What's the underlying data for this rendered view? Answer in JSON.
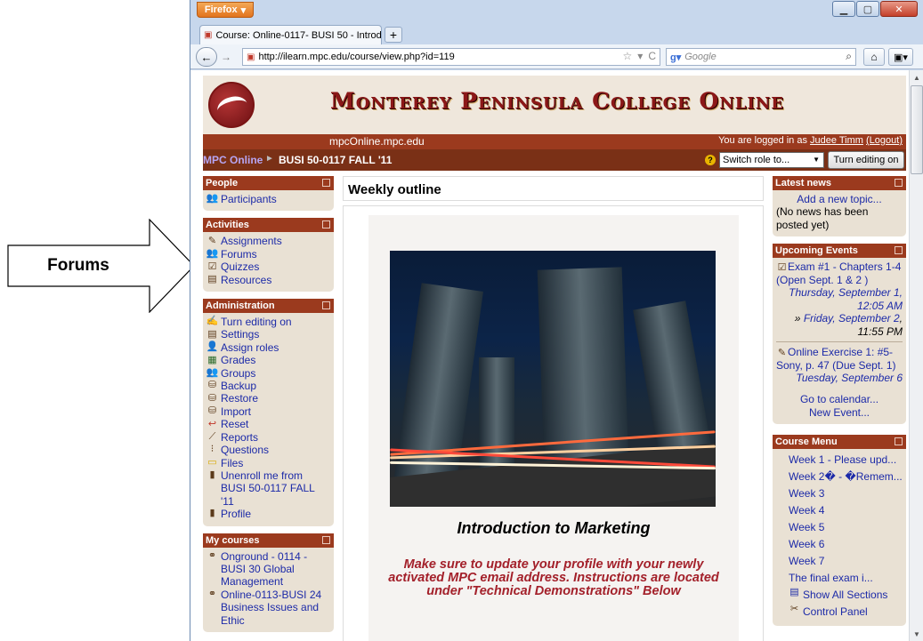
{
  "callout": {
    "label": "Forums"
  },
  "browser": {
    "app_button": "Firefox",
    "tab_title": "Course: Online-0117- BUSI 50 - Introduct...",
    "url": "http://ilearn.mpc.edu/course/view.php?id=119",
    "search_placeholder": "Google"
  },
  "header": {
    "site_title": "Monterey Peninsula College Online",
    "subdomain": "mpcOnline.mpc.edu",
    "login_prefix": "You are logged in as ",
    "user_name": "Judee Timm",
    "logout": "(Logout)"
  },
  "breadcrumb": {
    "root": "MPC Online",
    "separator": "►",
    "course": "BUSI 50-0117 FALL '11"
  },
  "controls": {
    "role_select": "Switch role to...",
    "edit_button": "Turn editing on"
  },
  "blocks": {
    "people": {
      "title": "People",
      "items": [
        {
          "label": "Participants",
          "icon": "participants-icon"
        }
      ]
    },
    "activities": {
      "title": "Activities",
      "items": [
        {
          "label": "Assignments",
          "icon": "assignment-icon"
        },
        {
          "label": "Forums",
          "icon": "forum-icon"
        },
        {
          "label": "Quizzes",
          "icon": "quiz-icon"
        },
        {
          "label": "Resources",
          "icon": "resource-icon"
        }
      ]
    },
    "administration": {
      "title": "Administration",
      "items": [
        {
          "label": "Turn editing on",
          "icon": "edit-icon"
        },
        {
          "label": "Settings",
          "icon": "settings-icon"
        },
        {
          "label": "Assign roles",
          "icon": "roles-icon"
        },
        {
          "label": "Grades",
          "icon": "grades-icon"
        },
        {
          "label": "Groups",
          "icon": "groups-icon"
        },
        {
          "label": "Backup",
          "icon": "backup-icon"
        },
        {
          "label": "Restore",
          "icon": "restore-icon"
        },
        {
          "label": "Import",
          "icon": "import-icon"
        },
        {
          "label": "Reset",
          "icon": "reset-icon"
        },
        {
          "label": "Reports",
          "icon": "reports-icon"
        },
        {
          "label": "Questions",
          "icon": "questions-icon"
        },
        {
          "label": "Files",
          "icon": "files-icon"
        },
        {
          "label": "Unenroll me from BUSI 50-0117 FALL '11",
          "icon": "unenroll-icon"
        },
        {
          "label": "Profile",
          "icon": "profile-icon"
        }
      ]
    },
    "my_courses": {
      "title": "My courses",
      "items": [
        {
          "label": "Onground - 0114 - BUSI 30 Global Management",
          "icon": "course-icon"
        },
        {
          "label": "Online-0113-BUSI 24 Business Issues and Ethic",
          "icon": "course-icon"
        }
      ]
    },
    "latest_news": {
      "title": "Latest news",
      "add_topic": "Add a new topic...",
      "empty": "(No news has been posted yet)"
    },
    "upcoming_events": {
      "title": "Upcoming Events",
      "event1": {
        "title": "Exam #1 - Chapters 1-4 (Open Sept. 1 & 2 )",
        "start": "Thursday, September 1, 12:05 AM",
        "end_prefix": "»",
        "end": "Friday, September 2",
        "end_time": ", 11:55 PM"
      },
      "event2": {
        "title": "Online Exercise 1: #5-Sony, p. 47 (Due Sept. 1)",
        "date": "Tuesday, September 6"
      },
      "go_calendar": "Go to calendar...",
      "new_event": "New Event..."
    },
    "course_menu": {
      "title": "Course Menu",
      "items": [
        "Week 1 - Please upd...",
        "Week 2� - �Remem...",
        "Week 3",
        "Week 4",
        "Week 5",
        "Week 6",
        "Week 7",
        "The final exam i..."
      ],
      "show_all": "Show All Sections",
      "control_panel": "Control Panel"
    }
  },
  "main": {
    "heading": "Weekly outline",
    "caption": "Introduction to Marketing",
    "notice": "Make sure to update your profile with your newly activated MPC email address. Instructions are located under \"Technical Demonstrations\" Below"
  },
  "colors": {
    "accent": "#9b3a1e",
    "block_bg": "#e9e1d4",
    "link": "#1c2aa8",
    "notice": "#a3202a"
  }
}
